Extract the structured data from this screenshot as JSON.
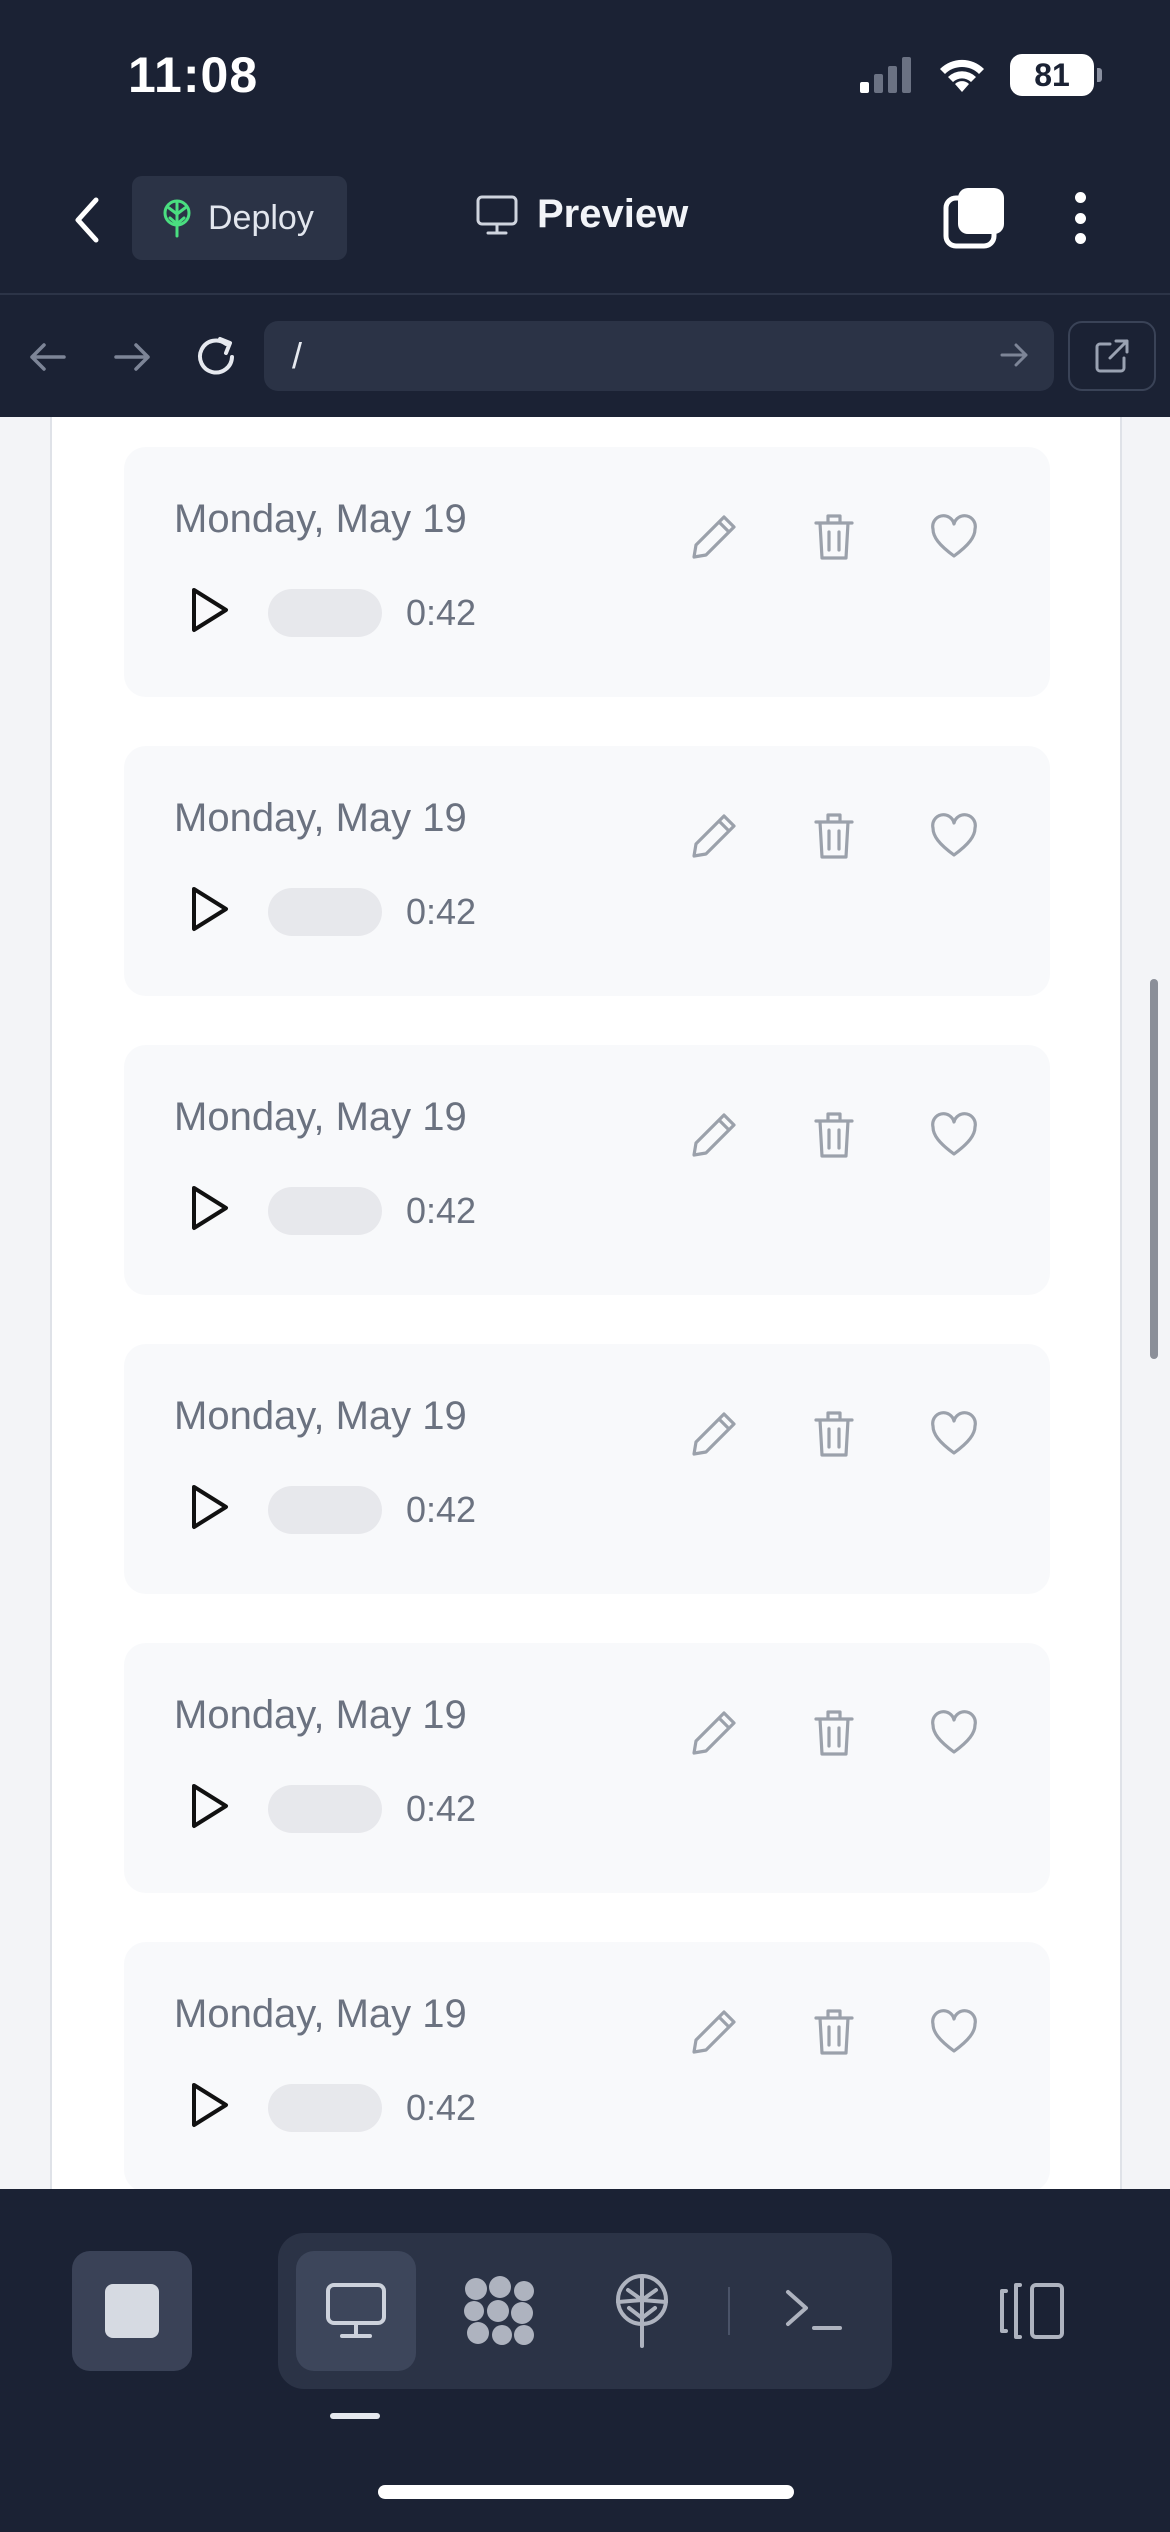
{
  "status_bar": {
    "time": "11:08",
    "battery": "81"
  },
  "nav": {
    "deploy_label": "Deploy",
    "title": "Preview"
  },
  "url_bar": {
    "url": "/"
  },
  "recordings": [
    {
      "date": "Monday, May 19",
      "duration": "0:42"
    },
    {
      "date": "Monday, May 19",
      "duration": "0:42"
    },
    {
      "date": "Monday, May 19",
      "duration": "0:42"
    },
    {
      "date": "Monday, May 19",
      "duration": "0:42"
    },
    {
      "date": "Monday, May 19",
      "duration": "0:42"
    },
    {
      "date": "Monday, May 19",
      "duration": "0:42"
    }
  ],
  "icons": {
    "back": "chevron-left-icon",
    "deploy": "deploy-tree-icon",
    "preview": "monitor-icon",
    "tabs": "tabs-icon",
    "more": "more-vertical-icon",
    "edit": "pencil-icon",
    "delete": "trash-icon",
    "favorite": "heart-icon",
    "play": "play-icon"
  },
  "toolbar": {
    "tools": [
      "preview",
      "blocks",
      "deploy",
      "terminal"
    ],
    "active_tool": "preview"
  },
  "colors": {
    "background": "#1b2234",
    "surface": "#2b3346",
    "card": "#f8f9fb",
    "accent_green": "#4ade80"
  }
}
